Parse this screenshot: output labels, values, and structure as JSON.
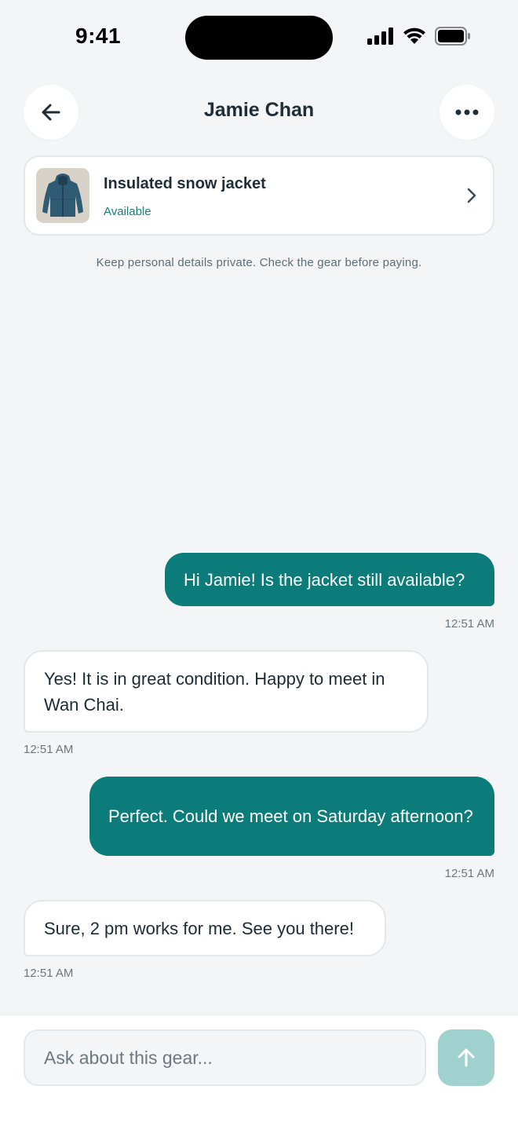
{
  "status_bar": {
    "time": "9:41"
  },
  "header": {
    "title": "Jamie Chan"
  },
  "listing": {
    "title": "Insulated snow jacket",
    "status": "Available"
  },
  "safety_note": "Keep personal details private. Check the gear before paying.",
  "messages": [
    {
      "direction": "outgoing",
      "text": "Hi Jamie! Is the jacket still available?",
      "time": "12:51 AM"
    },
    {
      "direction": "incoming",
      "text": "Yes! It is in great condition. Happy to meet in Wan Chai.",
      "time": "12:51 AM"
    },
    {
      "direction": "outgoing",
      "text": "Perfect. Could we meet on Saturday afternoon?",
      "time": "12:51 AM"
    },
    {
      "direction": "incoming",
      "text": "Sure, 2 pm works for me. See you there!",
      "time": "12:51 AM"
    }
  ],
  "composer": {
    "placeholder": "Ask about this gear..."
  },
  "colors": {
    "accent": "#0c7c7a",
    "send_disabled": "#9fd1cf",
    "background": "#f3f5f7"
  }
}
